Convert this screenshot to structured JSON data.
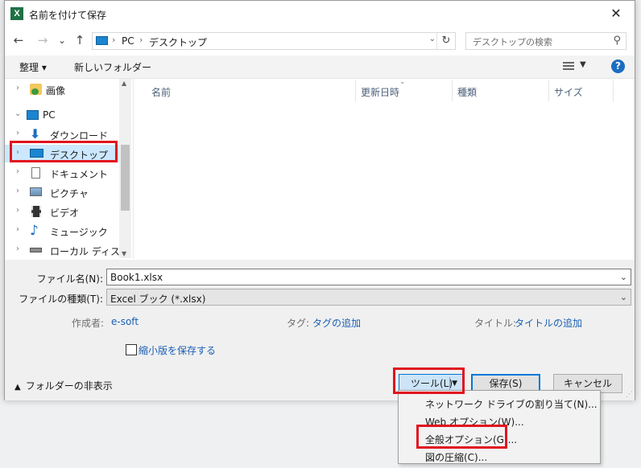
{
  "window": {
    "title": "名前を付けて保存",
    "app_icon": "excel-icon",
    "close": "✕"
  },
  "nav": {
    "back": "←",
    "forward": "→",
    "recent": "⌄",
    "up": "↑",
    "breadcrumbs": [
      "PC",
      "デスクトップ"
    ],
    "refresh": "↻",
    "search_placeholder": "デスクトップの検索"
  },
  "toolbar": {
    "organize": "整理 ▾",
    "new_folder": "新しいフォルダー",
    "help": "?"
  },
  "sidebar": {
    "items": [
      {
        "label": "画像",
        "icon": "pictures-folder-icon"
      },
      {
        "label": "PC",
        "icon": "pc-icon"
      },
      {
        "label": "ダウンロード",
        "icon": "download-icon"
      },
      {
        "label": "デスクトップ",
        "icon": "desktop-icon"
      },
      {
        "label": "ドキュメント",
        "icon": "document-icon"
      },
      {
        "label": "ピクチャ",
        "icon": "picture-icon"
      },
      {
        "label": "ビデオ",
        "icon": "video-icon"
      },
      {
        "label": "ミュージック",
        "icon": "music-icon"
      },
      {
        "label": "ローカル ディスク (C:",
        "icon": "disk-icon"
      }
    ]
  },
  "filelist": {
    "columns": [
      "名前",
      "更新日時",
      "種類",
      "サイズ"
    ]
  },
  "form": {
    "filename_label": "ファイル名(N):",
    "filename_value": "Book1.xlsx",
    "filetype_label": "ファイルの種類(T):",
    "filetype_value": "Excel ブック (*.xlsx)",
    "author_label": "作成者:",
    "author_value": "e-soft",
    "tags_label": "タグ:",
    "tags_value": "タグの追加",
    "title_label": "タイトル:",
    "title_value": "タイトルの追加",
    "thumbnail_label": "縮小版を保存する"
  },
  "footer": {
    "hide_folders": "フォルダーの非表示",
    "tools": "ツール(L)",
    "save": "保存(S)",
    "cancel": "キャンセル"
  },
  "menu": {
    "items": [
      "ネットワーク ドライブの割り当て(N)...",
      "Web オプション(W)...",
      "全般オプション(G)...",
      "図の圧縮(C)..."
    ]
  },
  "colors": {
    "highlight": "#e0141e",
    "selection": "#cce8ff",
    "accent": "#0078d7",
    "link": "#1a5fb4"
  }
}
